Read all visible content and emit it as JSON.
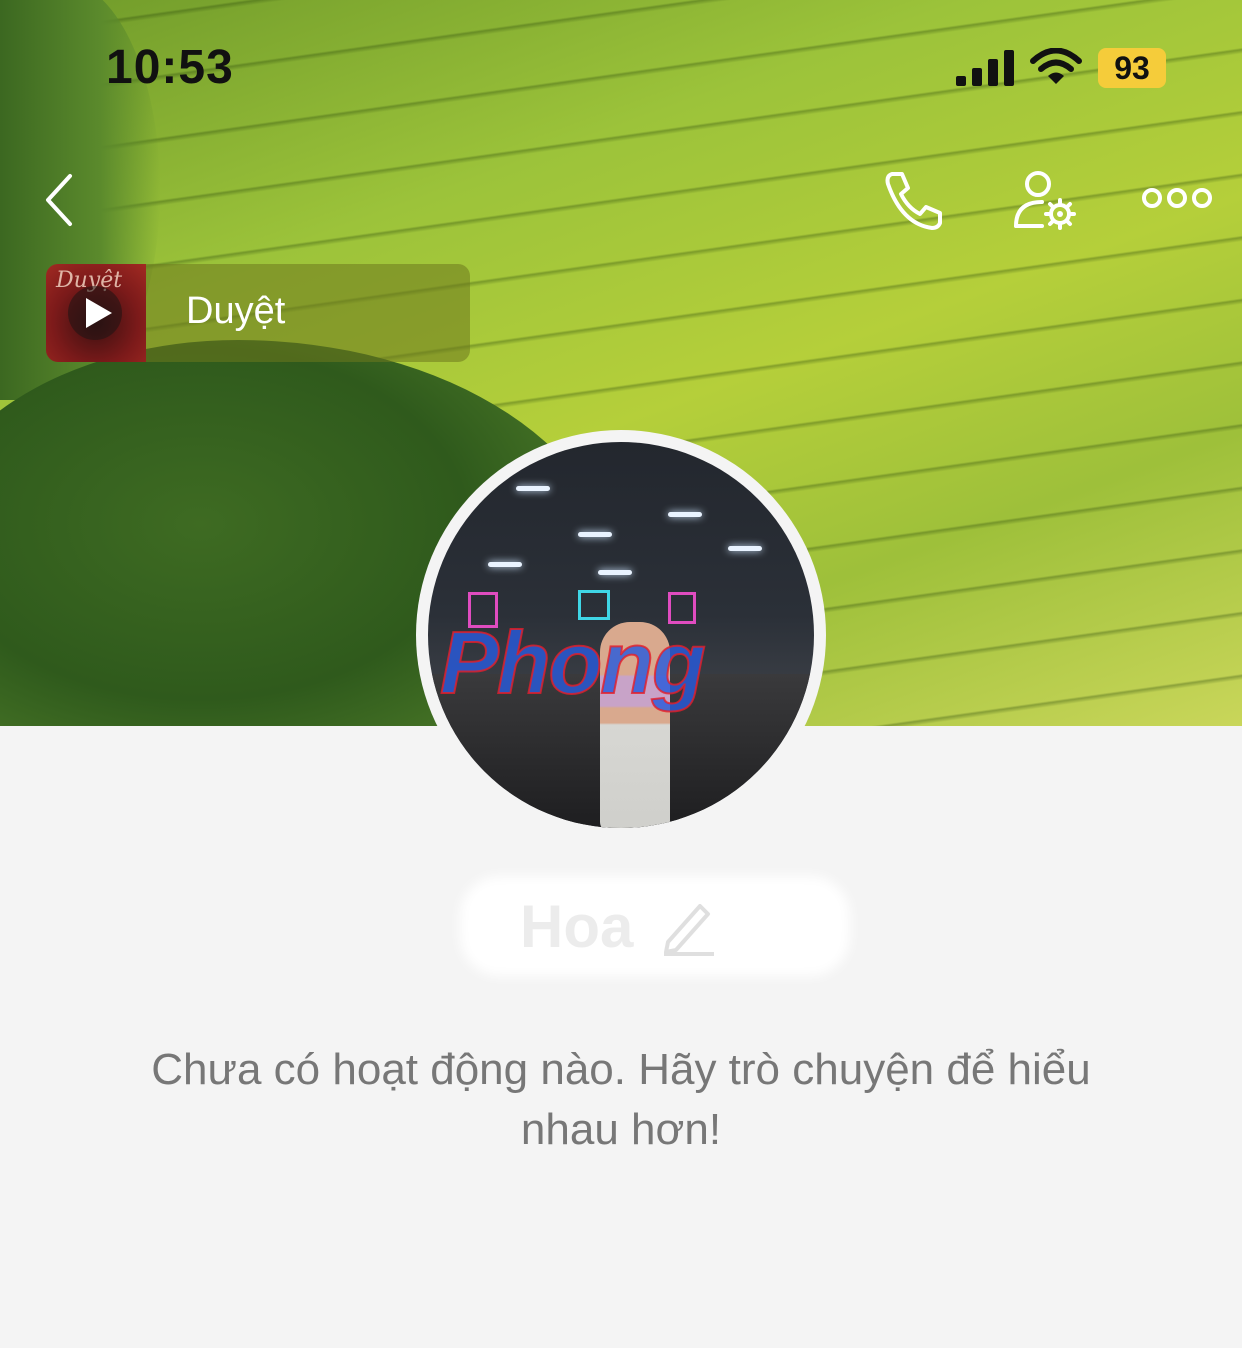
{
  "status_bar": {
    "time": "10:53",
    "battery": "93",
    "battery_color": "#f5cc3a"
  },
  "nav": {
    "back_icon": "chevron-left-icon",
    "call_icon": "phone-icon",
    "settings_icon": "user-settings-icon",
    "more_icon": "more-horizontal-icon"
  },
  "music": {
    "thumb_title": "Duyệt",
    "title": "Duyệt",
    "play_icon": "play-icon"
  },
  "profile": {
    "avatar_watermark": "Phong",
    "name": "Hoa",
    "edit_icon": "pencil-icon"
  },
  "empty_state": {
    "message": "Chưa có hoạt động nào. Hãy trò chuyện để hiểu nhau hơn!"
  }
}
